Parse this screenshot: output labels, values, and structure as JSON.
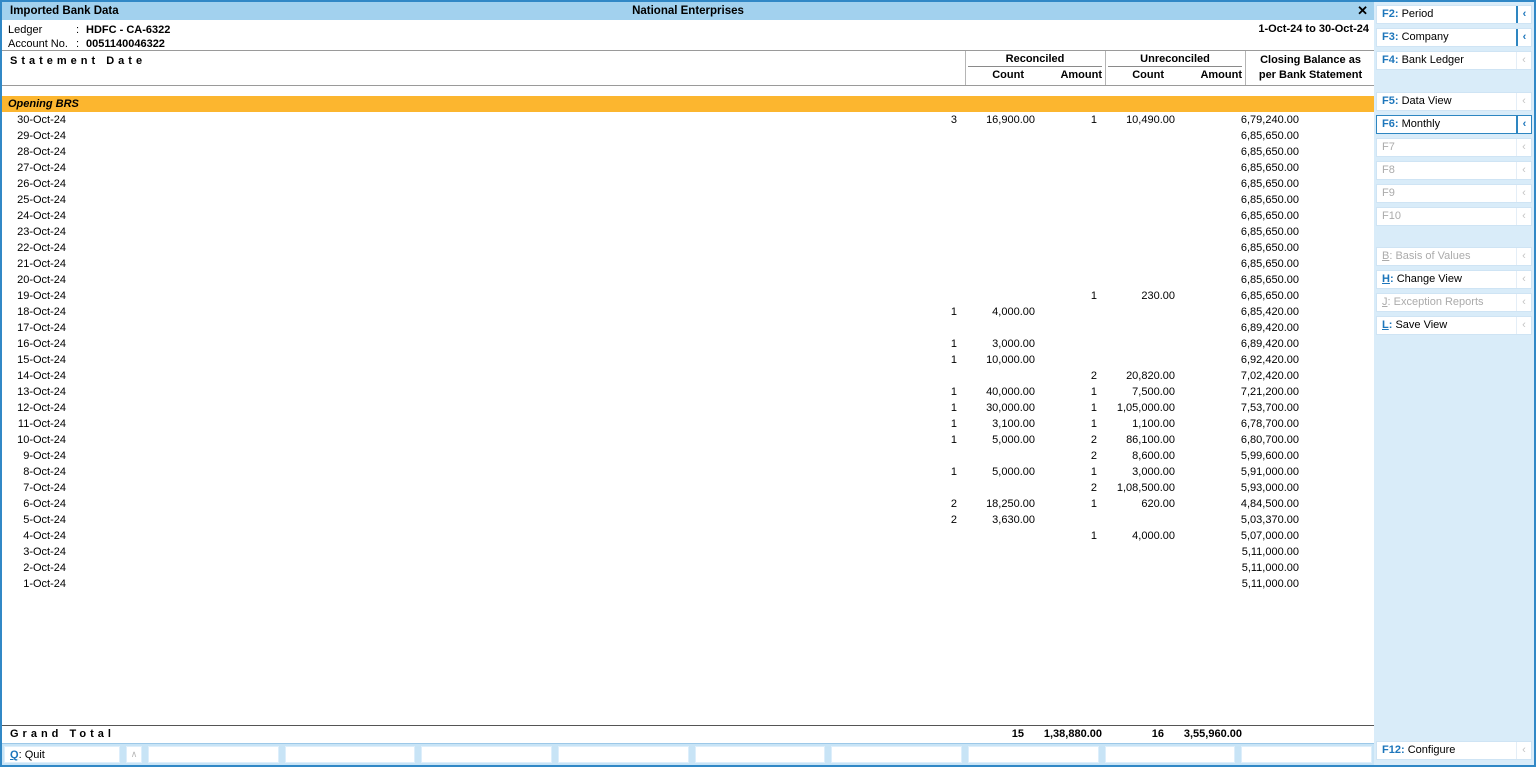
{
  "window": {
    "left_title": "Imported Bank Data",
    "center_title": "National Enterprises",
    "close_glyph": "✕"
  },
  "info": {
    "rows": [
      {
        "label": "Ledger",
        "value": "HDFC - CA-6322"
      },
      {
        "label": "Account No.",
        "value": "0051140046322"
      }
    ],
    "period": "1-Oct-24 to 30-Oct-24"
  },
  "table": {
    "date_header": "Statement Date",
    "groups": [
      {
        "label": "Reconciled",
        "cols": [
          "Count",
          "Amount"
        ]
      },
      {
        "label": "Unreconciled",
        "cols": [
          "Count",
          "Amount"
        ]
      }
    ],
    "closing_header": [
      "Closing Balance as",
      "per Bank Statement"
    ],
    "opening_row_label": "Opening BRS",
    "rows": [
      {
        "date": "30-Oct-24",
        "rc": "3",
        "ra": "16,900.00",
        "uc": "1",
        "ua": "10,490.00",
        "cb": "6,79,240.00"
      },
      {
        "date": "29-Oct-24",
        "rc": "",
        "ra": "",
        "uc": "",
        "ua": "",
        "cb": "6,85,650.00"
      },
      {
        "date": "28-Oct-24",
        "rc": "",
        "ra": "",
        "uc": "",
        "ua": "",
        "cb": "6,85,650.00"
      },
      {
        "date": "27-Oct-24",
        "rc": "",
        "ra": "",
        "uc": "",
        "ua": "",
        "cb": "6,85,650.00"
      },
      {
        "date": "26-Oct-24",
        "rc": "",
        "ra": "",
        "uc": "",
        "ua": "",
        "cb": "6,85,650.00"
      },
      {
        "date": "25-Oct-24",
        "rc": "",
        "ra": "",
        "uc": "",
        "ua": "",
        "cb": "6,85,650.00"
      },
      {
        "date": "24-Oct-24",
        "rc": "",
        "ra": "",
        "uc": "",
        "ua": "",
        "cb": "6,85,650.00"
      },
      {
        "date": "23-Oct-24",
        "rc": "",
        "ra": "",
        "uc": "",
        "ua": "",
        "cb": "6,85,650.00"
      },
      {
        "date": "22-Oct-24",
        "rc": "",
        "ra": "",
        "uc": "",
        "ua": "",
        "cb": "6,85,650.00"
      },
      {
        "date": "21-Oct-24",
        "rc": "",
        "ra": "",
        "uc": "",
        "ua": "",
        "cb": "6,85,650.00"
      },
      {
        "date": "20-Oct-24",
        "rc": "",
        "ra": "",
        "uc": "",
        "ua": "",
        "cb": "6,85,650.00"
      },
      {
        "date": "19-Oct-24",
        "rc": "",
        "ra": "",
        "uc": "1",
        "ua": "230.00",
        "cb": "6,85,650.00"
      },
      {
        "date": "18-Oct-24",
        "rc": "1",
        "ra": "4,000.00",
        "uc": "",
        "ua": "",
        "cb": "6,85,420.00"
      },
      {
        "date": "17-Oct-24",
        "rc": "",
        "ra": "",
        "uc": "",
        "ua": "",
        "cb": "6,89,420.00"
      },
      {
        "date": "16-Oct-24",
        "rc": "1",
        "ra": "3,000.00",
        "uc": "",
        "ua": "",
        "cb": "6,89,420.00"
      },
      {
        "date": "15-Oct-24",
        "rc": "1",
        "ra": "10,000.00",
        "uc": "",
        "ua": "",
        "cb": "6,92,420.00"
      },
      {
        "date": "14-Oct-24",
        "rc": "",
        "ra": "",
        "uc": "2",
        "ua": "20,820.00",
        "cb": "7,02,420.00"
      },
      {
        "date": "13-Oct-24",
        "rc": "1",
        "ra": "40,000.00",
        "uc": "1",
        "ua": "7,500.00",
        "cb": "7,21,200.00"
      },
      {
        "date": "12-Oct-24",
        "rc": "1",
        "ra": "30,000.00",
        "uc": "1",
        "ua": "1,05,000.00",
        "cb": "7,53,700.00"
      },
      {
        "date": "11-Oct-24",
        "rc": "1",
        "ra": "3,100.00",
        "uc": "1",
        "ua": "1,100.00",
        "cb": "6,78,700.00"
      },
      {
        "date": "10-Oct-24",
        "rc": "1",
        "ra": "5,000.00",
        "uc": "2",
        "ua": "86,100.00",
        "cb": "6,80,700.00"
      },
      {
        "date": "9-Oct-24",
        "rc": "",
        "ra": "",
        "uc": "2",
        "ua": "8,600.00",
        "cb": "5,99,600.00"
      },
      {
        "date": "8-Oct-24",
        "rc": "1",
        "ra": "5,000.00",
        "uc": "1",
        "ua": "3,000.00",
        "cb": "5,91,000.00"
      },
      {
        "date": "7-Oct-24",
        "rc": "",
        "ra": "",
        "uc": "2",
        "ua": "1,08,500.00",
        "cb": "5,93,000.00"
      },
      {
        "date": "6-Oct-24",
        "rc": "2",
        "ra": "18,250.00",
        "uc": "1",
        "ua": "620.00",
        "cb": "4,84,500.00"
      },
      {
        "date": "5-Oct-24",
        "rc": "2",
        "ra": "3,630.00",
        "uc": "",
        "ua": "",
        "cb": "5,03,370.00"
      },
      {
        "date": "4-Oct-24",
        "rc": "",
        "ra": "",
        "uc": "1",
        "ua": "4,000.00",
        "cb": "5,07,000.00"
      },
      {
        "date": "3-Oct-24",
        "rc": "",
        "ra": "",
        "uc": "",
        "ua": "",
        "cb": "5,11,000.00"
      },
      {
        "date": "2-Oct-24",
        "rc": "",
        "ra": "",
        "uc": "",
        "ua": "",
        "cb": "5,11,000.00"
      },
      {
        "date": "1-Oct-24",
        "rc": "",
        "ra": "",
        "uc": "",
        "ua": "",
        "cb": "5,11,000.00"
      }
    ],
    "grand_total": {
      "label": "Grand Total",
      "rc": "15",
      "ra": "1,38,880.00",
      "uc": "16",
      "ua": "3,55,960.00"
    }
  },
  "bottombar": {
    "quit_key": "Q",
    "quit_label": "Quit",
    "caret_glyph": "∧",
    "empty_slots": 9
  },
  "sidebar": {
    "chevron_glyph": "‹",
    "top": [
      {
        "key": "F2",
        "label": "Period",
        "state": "active",
        "chev": "blue"
      },
      {
        "key": "F3",
        "label": "Company",
        "state": "active",
        "chev": "blue"
      },
      {
        "key": "F4",
        "label": "Bank Ledger",
        "state": "active",
        "chev": "gray"
      }
    ],
    "view": [
      {
        "key": "F5",
        "label": "Data View",
        "state": "active",
        "chev": "gray"
      },
      {
        "key": "F6",
        "label": "Monthly",
        "state": "selected",
        "chev": "blue"
      },
      {
        "key": "F7",
        "label": "",
        "state": "disabled",
        "chev": "gray"
      },
      {
        "key": "F8",
        "label": "",
        "state": "disabled",
        "chev": "gray"
      },
      {
        "key": "F9",
        "label": "",
        "state": "disabled",
        "chev": "gray"
      },
      {
        "key": "F10",
        "label": "",
        "state": "disabled",
        "chev": "gray"
      }
    ],
    "tools": [
      {
        "key": "B",
        "label": "Basis of Values",
        "state": "disabled",
        "chev": "gray",
        "ul": true
      },
      {
        "key": "H",
        "label": "Change View",
        "state": "active",
        "chev": "gray",
        "ul": true
      },
      {
        "key": "J",
        "label": "Exception Reports",
        "state": "disabled",
        "chev": "gray",
        "ul": true
      },
      {
        "key": "L",
        "label": "Save View",
        "state": "active",
        "chev": "gray",
        "ul": true
      }
    ],
    "bottom": {
      "key": "F12",
      "label": "Configure",
      "state": "active",
      "chev": "gray"
    }
  },
  "colors": {
    "titlebar": "#a2d1ee",
    "sidebar_bg": "#d9ecf9",
    "key_blue": "#1d76bb",
    "selected_row_orange": "#fcb62f",
    "bottombar_bg": "#c8e4f6",
    "disabled_gray": "#ababab"
  }
}
